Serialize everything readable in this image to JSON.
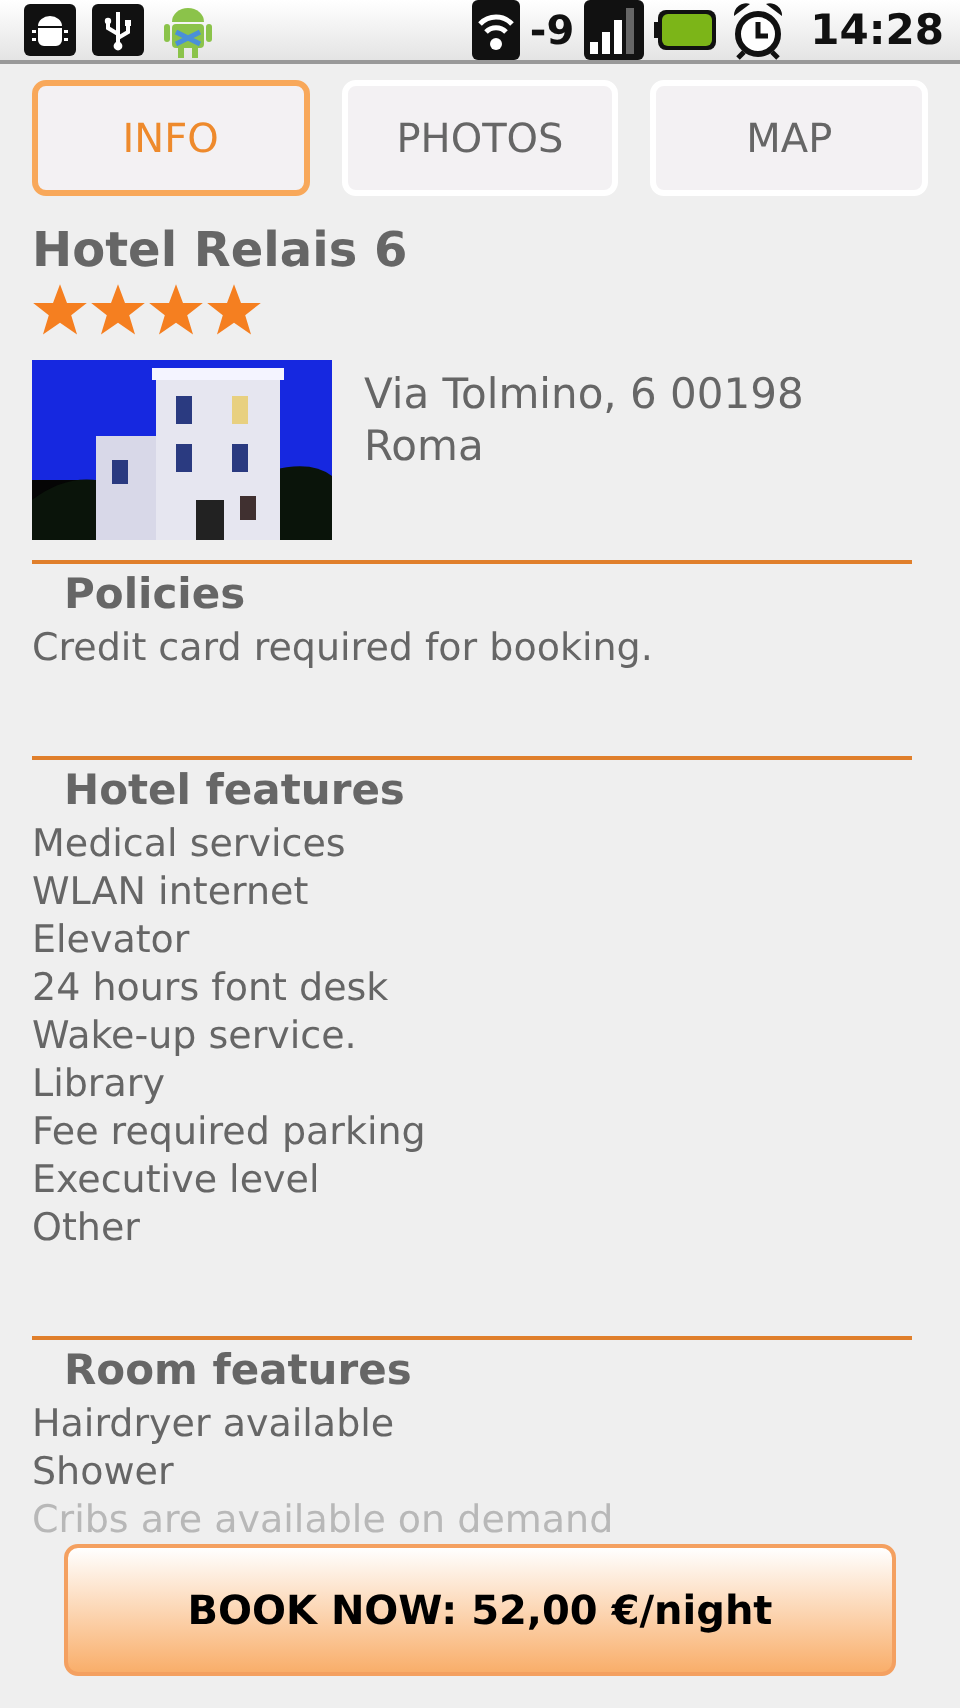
{
  "status_bar": {
    "signal_text": "-9",
    "time": "14:28"
  },
  "tabs": [
    {
      "label": "INFO",
      "selected": true
    },
    {
      "label": "PHOTOS",
      "selected": false
    },
    {
      "label": "MAP",
      "selected": false
    }
  ],
  "hotel": {
    "name": "Hotel Relais 6",
    "stars": 4,
    "address": "Via Tolmino, 6 00198 Roma"
  },
  "sections": [
    {
      "title": "Policies",
      "items": [
        "Credit card required for booking."
      ]
    },
    {
      "title": "Hotel features",
      "items": [
        "Medical services",
        "WLAN internet",
        "Elevator",
        "24 hours font desk",
        "Wake-up service.",
        "Library",
        "Fee required parking",
        "Executive level",
        "Other"
      ]
    },
    {
      "title": "Room features",
      "items": [
        "Hairdryer available",
        "Shower",
        "Cribs are available on demand"
      ]
    }
  ],
  "book_button": "BOOK NOW: 52,00 €/night"
}
